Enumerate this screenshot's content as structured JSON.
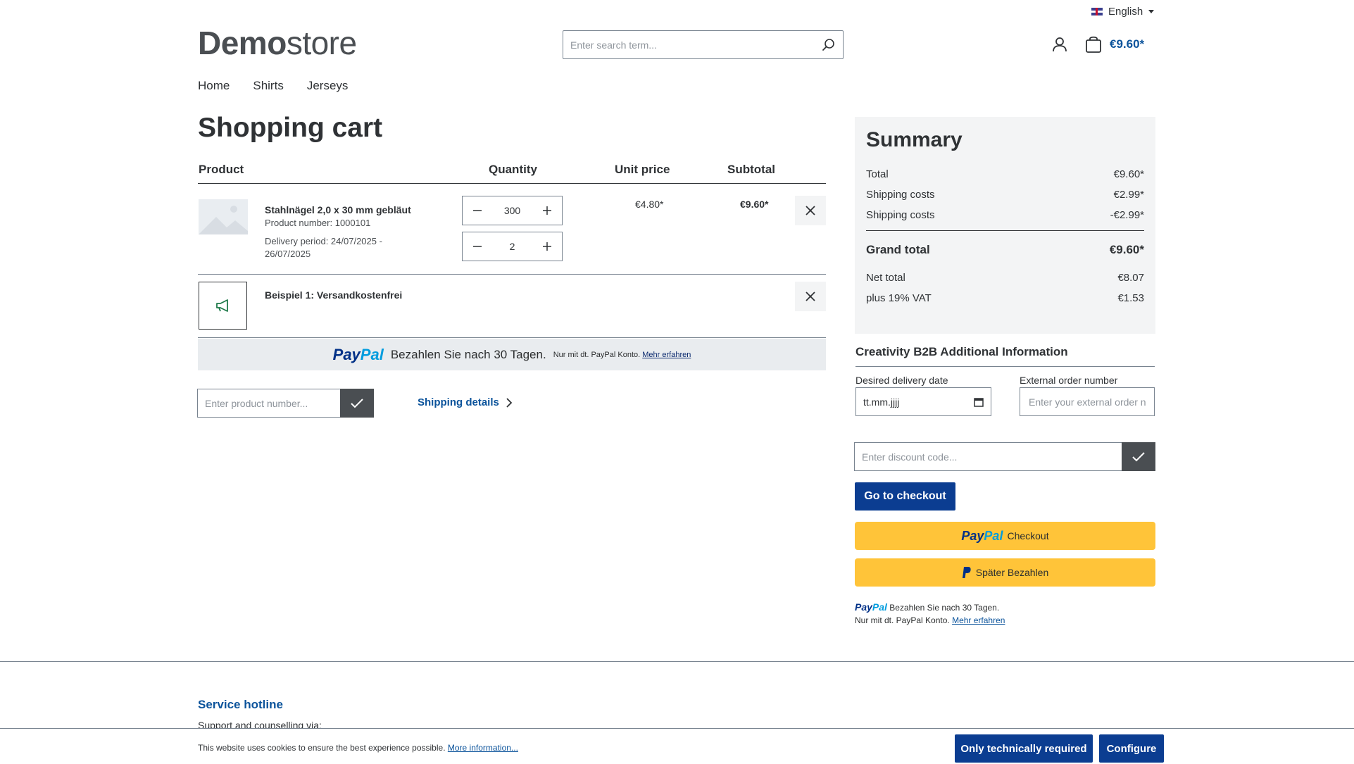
{
  "header": {
    "language": "English",
    "logo_bold": "Demo",
    "logo_light": "store",
    "search_placeholder": "Enter search term...",
    "cart_total": "€9.60*"
  },
  "nav": [
    "Home",
    "Shirts",
    "Jerseys"
  ],
  "cart": {
    "title": "Shopping cart",
    "columns": {
      "product": "Product",
      "quantity": "Quantity",
      "unit_price": "Unit price",
      "subtotal": "Subtotal"
    },
    "item": {
      "name": "Stahlnägel 2,0 x 30 mm gebläut",
      "product_number": "Product number: 1000101",
      "delivery_1": "Delivery period: 24/07/2025 -",
      "delivery_2": "26/07/2025",
      "qty": "300",
      "qty2": "2",
      "unit_price": "€4.80*",
      "subtotal": "€9.60*"
    },
    "promo": {
      "name": "Beispiel 1: Versandkostenfrei"
    },
    "paypal_banner": {
      "text": "Bezahlen Sie nach 30 Tagen.",
      "small": "Nur mit dt. PayPal Konto.",
      "link": "Mehr erfahren"
    },
    "product_number_placeholder": "Enter product number...",
    "shipping_details": "Shipping details"
  },
  "summary": {
    "title": "Summary",
    "rows": [
      {
        "label": "Total",
        "value": "€9.60*"
      },
      {
        "label": "Shipping costs",
        "value": "€2.99*"
      },
      {
        "label": "Shipping costs",
        "value": "-€2.99*"
      }
    ],
    "grand_total": {
      "label": "Grand total",
      "value": "€9.60*"
    },
    "net_total": {
      "label": "Net total",
      "value": "€8.07"
    },
    "vat": {
      "label": "plus 19% VAT",
      "value": "€1.53"
    }
  },
  "b2b": {
    "title": "Creativity B2B Additional Information",
    "delivery_label": "Desired delivery date",
    "delivery_value": "tt.mm.jjjj",
    "external_label": "External order number",
    "external_placeholder": "Enter your external order number"
  },
  "discount_placeholder": "Enter discount code...",
  "checkout": "Go to checkout",
  "paypal": {
    "checkout_logo_1": "Pay",
    "checkout_logo_2": "Pal",
    "checkout_text": "Checkout",
    "later_text": "Später Bezahlen",
    "note_line1": "Bezahlen Sie nach 30 Tagen.",
    "note_line2": "Nur mit dt. PayPal Konto.",
    "note_link": "Mehr erfahren"
  },
  "footer": {
    "hotline": "Service hotline",
    "support": "Support and counselling via:"
  },
  "cookie": {
    "text": "This website uses cookies to ensure the best experience possible.",
    "link": "More information...",
    "btn_required": "Only technically required",
    "btn_configure": "Configure"
  },
  "colors": {
    "accent": "#0b539b",
    "primary_button": "#0b3d91",
    "paypal_yellow": "#ffc439"
  }
}
